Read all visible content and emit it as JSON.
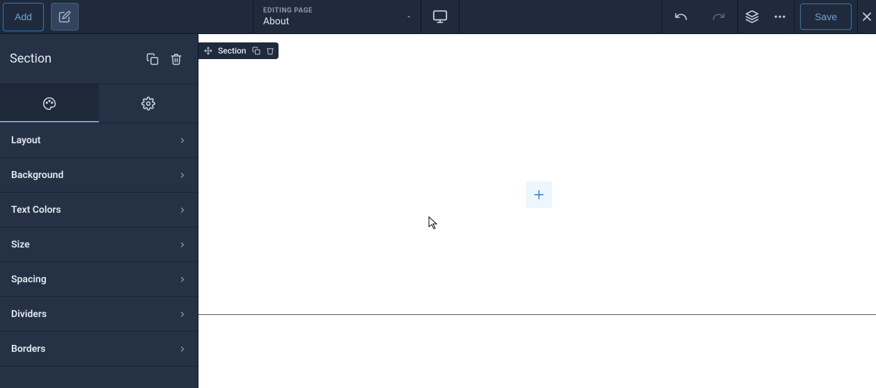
{
  "topbar": {
    "add_label": "Add",
    "editing_label": "EDITING PAGE",
    "page_name": "About",
    "save_label": "Save"
  },
  "panel": {
    "title": "Section",
    "items": [
      {
        "label": "Layout"
      },
      {
        "label": "Background"
      },
      {
        "label": "Text Colors"
      },
      {
        "label": "Size"
      },
      {
        "label": "Spacing"
      },
      {
        "label": "Dividers"
      },
      {
        "label": "Borders"
      }
    ]
  },
  "canvas": {
    "section_tag_label": "Section"
  },
  "colors": {
    "accent": "#3a8cd8",
    "panel_bg": "#253246",
    "topbar_bg": "#1f2b3d"
  }
}
